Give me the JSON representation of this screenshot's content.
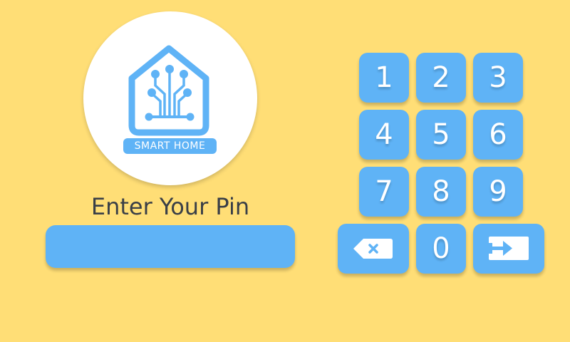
{
  "logo": {
    "brand_label": "SMART HOME",
    "icon": "circuit-house-icon"
  },
  "prompt": {
    "text": "Enter Your Pin"
  },
  "pin_input": {
    "value": ""
  },
  "keypad": {
    "keys": [
      "1",
      "2",
      "3",
      "4",
      "5",
      "6",
      "7",
      "8",
      "9",
      "0"
    ],
    "backspace_icon": "backspace-icon",
    "submit_icon": "enter-arrow-icon"
  },
  "colors": {
    "background": "#FFDE76",
    "accent": "#5FB3F6",
    "logo_background": "#FFFFFF",
    "text": "#3A3F47"
  }
}
